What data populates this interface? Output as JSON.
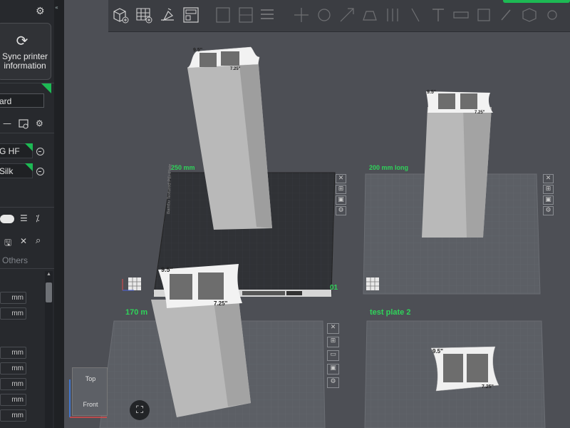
{
  "sidebar": {
    "sync_label_1": "Sync printer",
    "sync_label_2": "information",
    "printer_field": "ard",
    "filament_1": "G HF",
    "filament_2": "Silk",
    "tab_others": "Others",
    "unit": "mm"
  },
  "plates": {
    "plate1_label": "250 mm",
    "plate2_label": "200 mm long",
    "plate3_label": "170 m",
    "plate4_label": "test plate 2",
    "plate1_suffix": "01"
  },
  "model": {
    "dim_a": "9.5\"",
    "dim_b": "7.25\""
  },
  "nav_cube": {
    "top": "Top",
    "front": "Front"
  },
  "colors": {
    "accent": "#1db954",
    "background": "#4d4f55",
    "sidebar": "#27292d"
  },
  "icons": {
    "gear": "gear-icon",
    "sync": "sync-icon",
    "save": "save-icon",
    "close": "close-icon",
    "search": "search-icon"
  }
}
